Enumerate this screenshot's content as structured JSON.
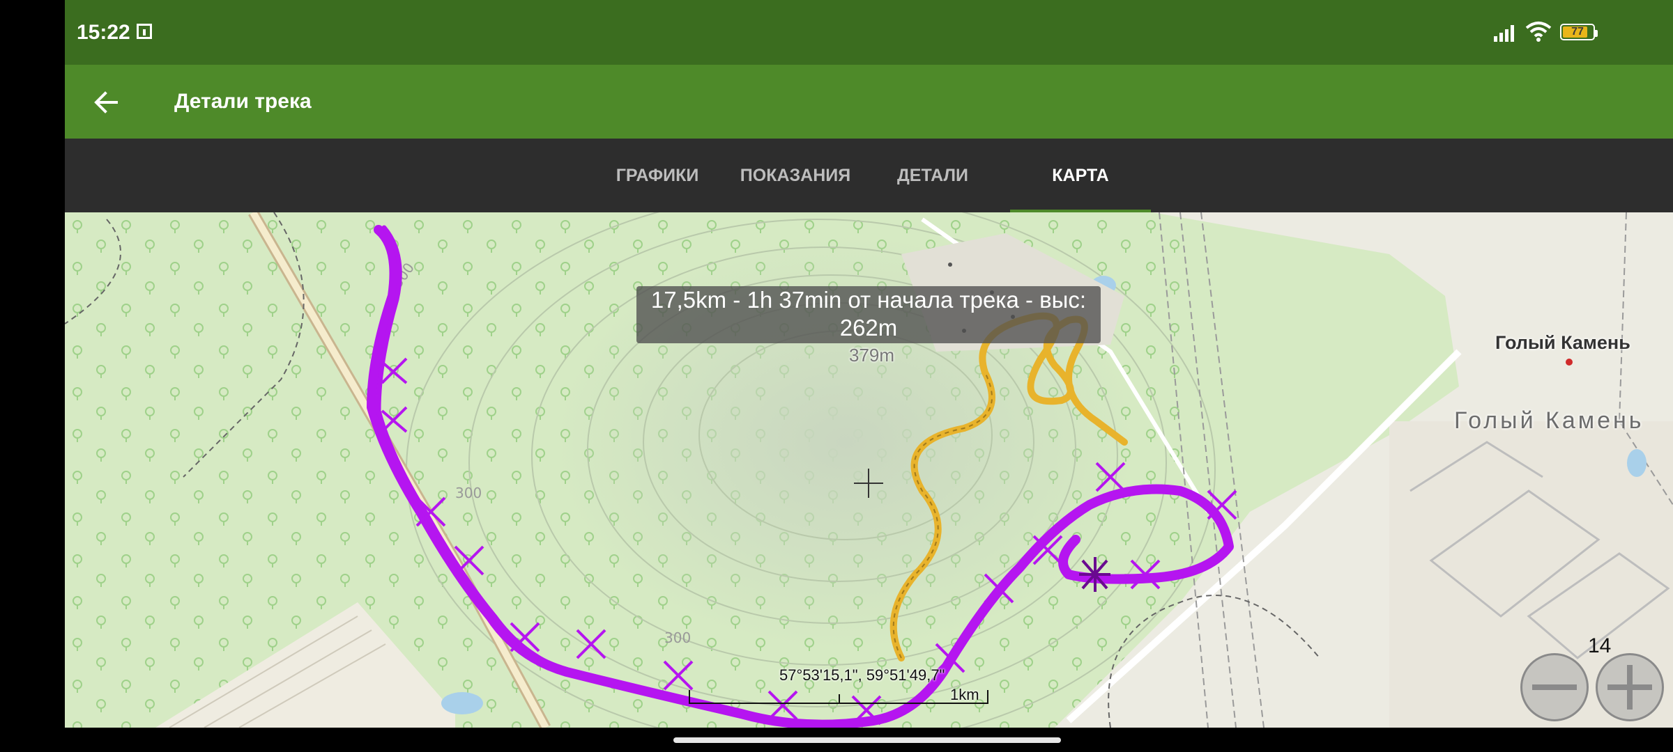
{
  "status_bar": {
    "time": "15:22",
    "battery_level": "77",
    "battery_color": "#e9b51a",
    "icons": [
      "notification-icon",
      "signal-icon",
      "wifi-icon",
      "battery-icon"
    ]
  },
  "app_bar": {
    "title": "Детали трека",
    "back_icon": "arrow-left-icon",
    "color": "#4e8a29"
  },
  "tabs": [
    {
      "label": "ГРАФИКИ",
      "active": false
    },
    {
      "label": "ПОКАЗАНИЯ",
      "active": false
    },
    {
      "label": "ДЕТАЛИ",
      "active": false
    },
    {
      "label": "КАРТА",
      "active": true
    }
  ],
  "map": {
    "info_line1": "17,5km - 1h 37min от начала трека - выс:",
    "info_line2": "262m",
    "peak_label": "379m",
    "contour_labels": [
      "300",
      "300",
      "300"
    ],
    "place_label_bold": "Голый Камень",
    "place_label_large": "Голый Камень",
    "coordinates": "57°53'15,1\", 59°51'49,7\"",
    "scale_label": "1km",
    "zoom_level": "14",
    "track_color": "#b515f0",
    "secondary_track_color": "#e8b32c"
  },
  "zoom_controls": {
    "zoom_out_icon": "minus-icon",
    "zoom_in_icon": "plus-icon"
  }
}
